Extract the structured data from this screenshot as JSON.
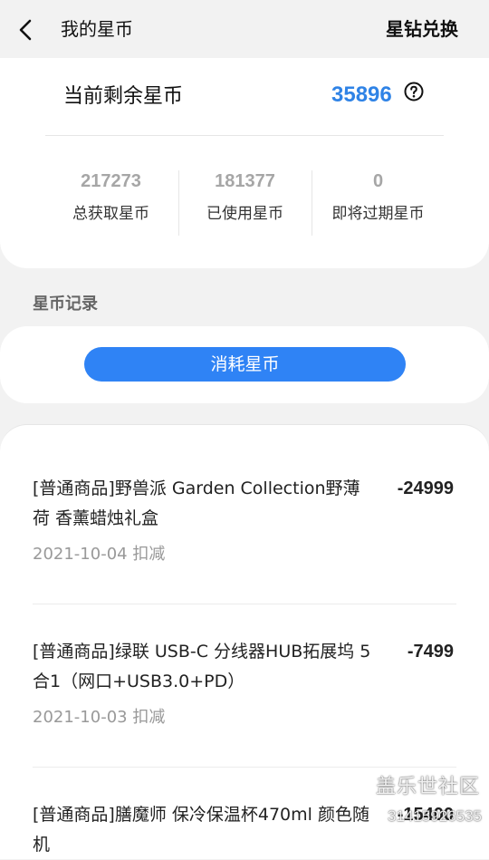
{
  "header": {
    "title": "我的星币",
    "right_action": "星钻兑换",
    "back_icon": "chevron-left-icon"
  },
  "summary": {
    "balance_label": "当前剩余星币",
    "balance_value": "35896",
    "help_icon": "question-circle-icon",
    "stats": [
      {
        "value": "217273",
        "label": "总获取星币"
      },
      {
        "value": "181377",
        "label": "已使用星币"
      },
      {
        "value": "0",
        "label": "即将过期星币"
      }
    ]
  },
  "records_section": {
    "title": "星币记录",
    "filter_button": "消耗星币"
  },
  "records": [
    {
      "title": "[普通商品]野兽派 Garden Collection野薄荷 香薰蜡烛礼盒",
      "amount": "-24999",
      "date": "2021-10-04 扣减"
    },
    {
      "title": "[普通商品]绿联 USB-C 分线器HUB拓展坞 5合1（网口+USB3.0+PD）",
      "amount": "-7499",
      "date": "2021-10-03 扣减"
    },
    {
      "title": "[普通商品]膳魔师 保冷保温杯470ml 颜色随机",
      "amount": "-15400",
      "date": ""
    }
  ],
  "watermark": {
    "brand": "盖乐世社区",
    "id": "31415926535"
  },
  "colors": {
    "accent": "#2f83e6",
    "button": "#2f83f5",
    "background": "#f2f2f2"
  }
}
